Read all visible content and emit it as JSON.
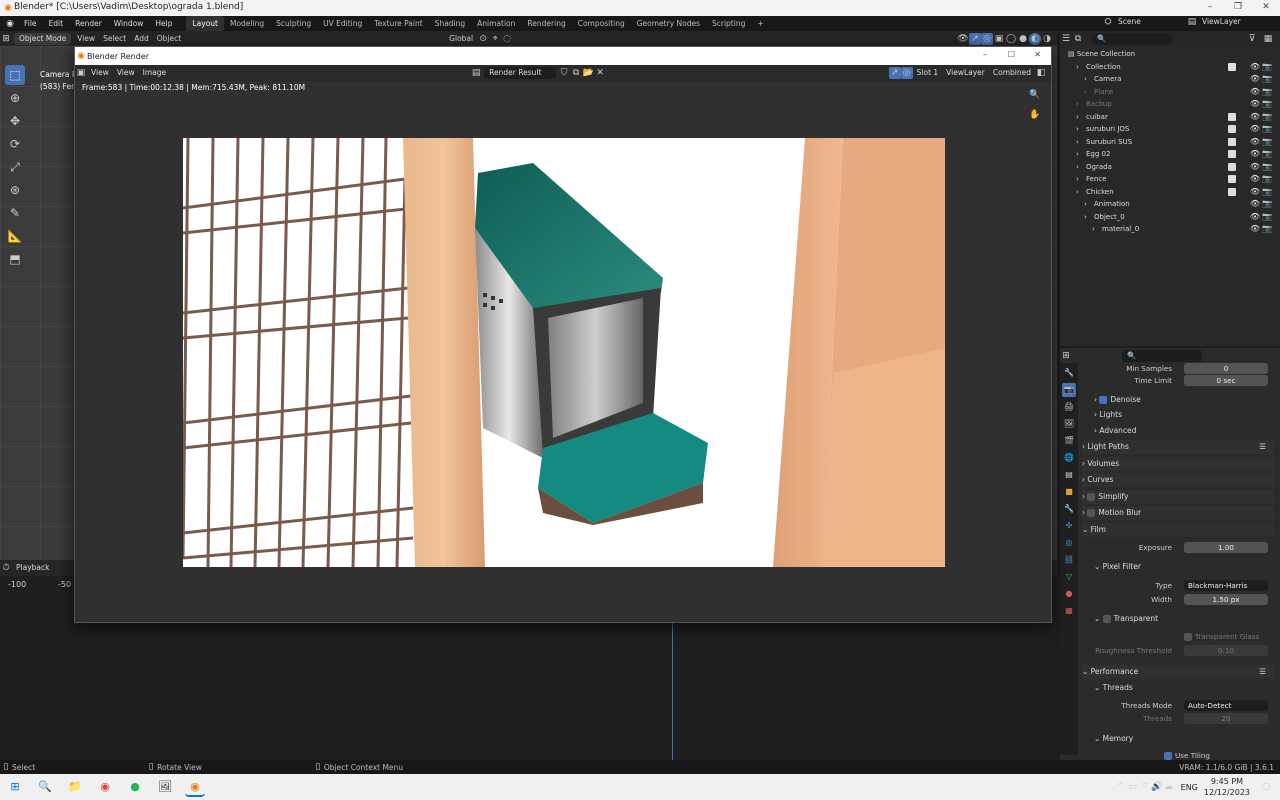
{
  "window_title": "Blender* [C:\\Users\\Vadim\\Desktop\\ograda 1.blend]",
  "menu": [
    "File",
    "Edit",
    "Render",
    "Window",
    "Help"
  ],
  "workspaces": [
    "Layout",
    "Modeling",
    "Sculpting",
    "UV Editing",
    "Texture Paint",
    "Shading",
    "Animation",
    "Rendering",
    "Compositing",
    "Geometry Nodes",
    "Scripting"
  ],
  "active_workspace": "Layout",
  "scene": "Scene",
  "view_layer": "ViewLayer",
  "viewport_header": {
    "mode": "Object Mode",
    "view": "View",
    "select": "Select",
    "add": "Add",
    "object": "Object",
    "orientation": "Global"
  },
  "viewport_overlay": {
    "line1": "Camera Pe",
    "line2": "(583) Fenc"
  },
  "render_window": {
    "title": "Blender Render",
    "view": "View",
    "view2": "View",
    "image": "Image",
    "result": "Render Result",
    "slot": "Slot 1",
    "layer": "ViewLayer",
    "pass": "Combined",
    "stats": "Frame:583 | Time:00:12.38 | Mem:715.43M, Peak: 811.10M"
  },
  "timeline": {
    "playback": "Playback",
    "n1": "-100",
    "n2": "-50"
  },
  "outliner": {
    "title": "Scene Collection",
    "rows": [
      {
        "name": "Collection",
        "indent": 1,
        "dim": false
      },
      {
        "name": "Camera",
        "indent": 2,
        "dim": false
      },
      {
        "name": "Plane",
        "indent": 2,
        "dim": true
      },
      {
        "name": "Backup",
        "indent": 1,
        "dim": true
      },
      {
        "name": "cuibar",
        "indent": 1,
        "dim": false
      },
      {
        "name": "suruburi JOS",
        "indent": 1,
        "dim": false
      },
      {
        "name": "Suruburi SUS",
        "indent": 1,
        "dim": false
      },
      {
        "name": "Egg 02",
        "indent": 1,
        "dim": false
      },
      {
        "name": "Ograda",
        "indent": 1,
        "dim": false
      },
      {
        "name": "Fence",
        "indent": 1,
        "dim": false
      },
      {
        "name": "Chicken",
        "indent": 1,
        "dim": false
      },
      {
        "name": "Animation",
        "indent": 2,
        "dim": false
      },
      {
        "name": "Object_0",
        "indent": 2,
        "dim": false
      },
      {
        "name": "material_0",
        "indent": 3,
        "dim": false
      }
    ]
  },
  "properties": {
    "min_samples_label": "Min Samples",
    "min_samples": "0",
    "time_limit_label": "Time Limit",
    "time_limit": "0 sec",
    "denoise": "Denoise",
    "lights": "Lights",
    "advanced": "Advanced",
    "light_paths": "Light Paths",
    "volumes": "Volumes",
    "curves": "Curves",
    "simplify": "Simplify",
    "motion_blur": "Motion Blur",
    "film": "Film",
    "exposure_label": "Exposure",
    "exposure": "1.00",
    "pixel_filter": "Pixel Filter",
    "type_label": "Type",
    "type": "Blackman-Harris",
    "width_label": "Width",
    "width": "1.50 px",
    "transparent": "Transparent",
    "transparent_glass": "Transparent Glass",
    "roughness_label": "Roughness Threshold",
    "roughness": "0.10",
    "performance": "Performance",
    "threads": "Threads",
    "threads_mode_label": "Threads Mode",
    "threads_mode": "Auto-Detect",
    "threads_count_label": "Threads",
    "threads_count": "20",
    "memory": "Memory",
    "use_tiling": "Use Tiling"
  },
  "status": {
    "select": "Select",
    "rotate": "Rotate View",
    "context": "Object Context Menu",
    "vram": "VRAM: 1.1/6.0 GiB | 3.6.1"
  },
  "taskbar": {
    "lang": "ENG",
    "time": "9:45 PM",
    "date": "12/12/2023"
  }
}
